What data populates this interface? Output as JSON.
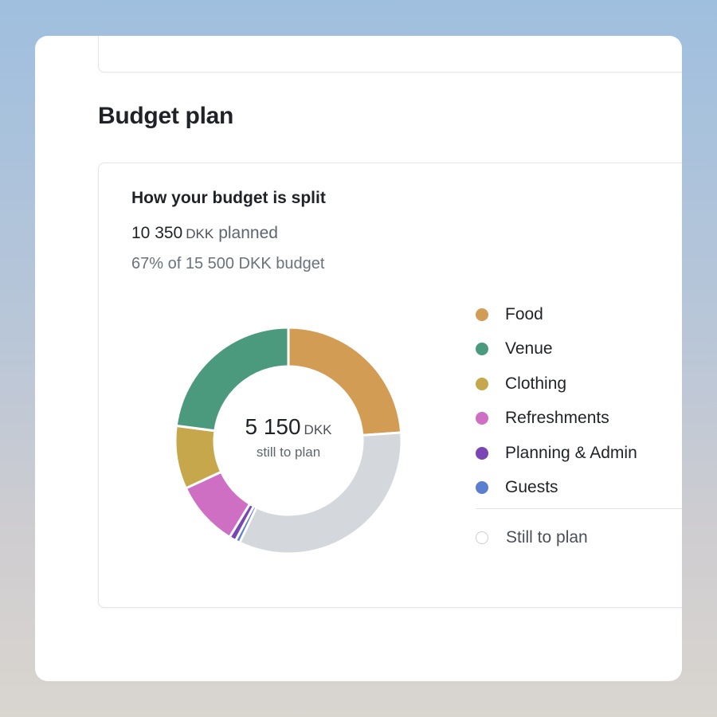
{
  "section": {
    "title": "Budget plan"
  },
  "card": {
    "heading": "How your budget is split",
    "planned_amount": "10 350",
    "planned_currency": "DKK",
    "planned_suffix": "planned",
    "budget_summary": "67% of 15 500 DKK budget"
  },
  "donut": {
    "center_amount": "5 150",
    "center_currency": "DKK",
    "center_label": "still to plan"
  },
  "chart_data": {
    "type": "pie",
    "total": 15500,
    "slices": [
      {
        "name": "Food",
        "value": 3700,
        "color": "#d39c55"
      },
      {
        "name": "Still to plan",
        "value": 5150,
        "color": "#d4d8dc"
      },
      {
        "name": "Guests",
        "value": 100,
        "color": "#5b7fce"
      },
      {
        "name": "Planning & Admin",
        "value": 150,
        "color": "#7a45b5"
      },
      {
        "name": "Refreshments",
        "value": 1450,
        "color": "#cf6fc4"
      },
      {
        "name": "Clothing",
        "value": 1400,
        "color": "#c6a74b"
      },
      {
        "name": "Venue",
        "value": 3550,
        "color": "#4c9a7e"
      }
    ]
  },
  "legend": {
    "items": [
      {
        "label": "Food",
        "color": "#d39c55"
      },
      {
        "label": "Venue",
        "color": "#4c9a7e"
      },
      {
        "label": "Clothing",
        "color": "#c6a74b"
      },
      {
        "label": "Refreshments",
        "color": "#cf6fc4"
      },
      {
        "label": "Planning & Admin",
        "color": "#7a45b5"
      },
      {
        "label": "Guests",
        "color": "#5b7fce"
      }
    ],
    "rest_label": "Still to plan"
  }
}
